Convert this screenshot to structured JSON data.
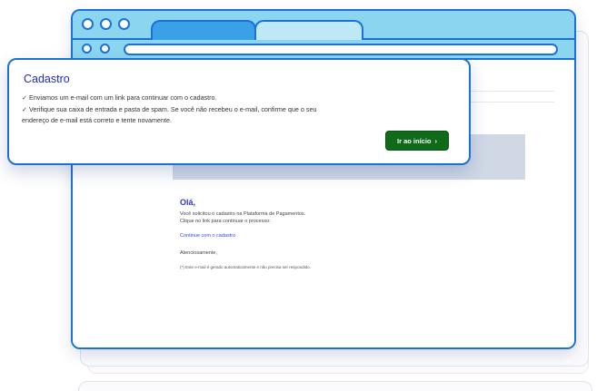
{
  "popup": {
    "title": "Cadastro",
    "line1": "✓ Enviamos um e-mail com um link para continuar com o cadastro.",
    "line2": "✓ Verifique sua caixa de entrada e pasta de spam. Se você não recebeu o e-mail, confirme que o seu",
    "line3": "endereço de e-mail está correto e tente novamente.",
    "button_label": "Ir ao início",
    "button_icon": "chevron-right-icon"
  },
  "email": {
    "greeting": "Olá,",
    "line1": "Você solicitou o cadastro na Plataforma de Pagamentos.",
    "line2": "Clique no link para continuar o processo:",
    "link_text": "Continue com o cadastro",
    "signoff": "Atenciosamente,",
    "note": "(*) Este e-mail é gerado automaticamente e não precisa ser respondido."
  },
  "colors": {
    "accent": "#1b72d6",
    "title": "#1d2fb8",
    "button": "#0f6a1a",
    "titlebar": "#8cd5f0"
  }
}
